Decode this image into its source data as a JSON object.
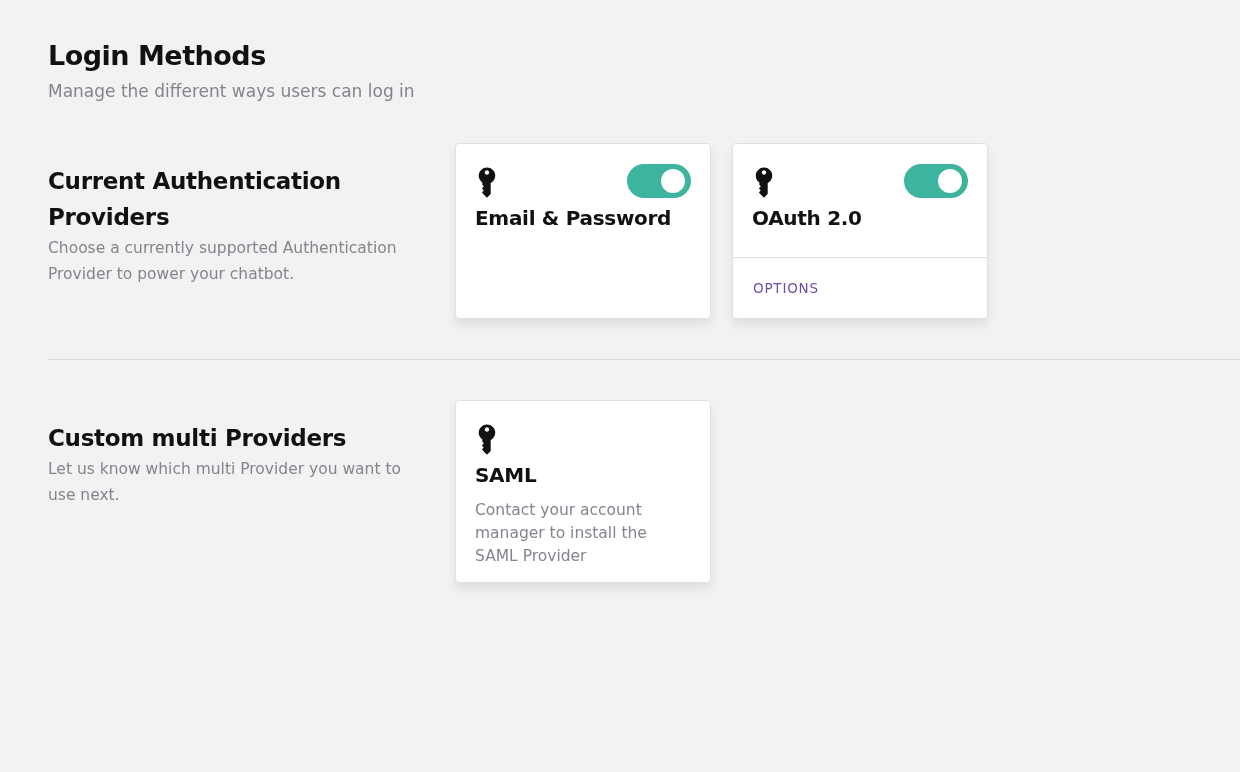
{
  "page": {
    "title": "Login Methods",
    "subtitle": "Manage the different ways users can log in"
  },
  "sections": [
    {
      "title": "Current Authentication Providers",
      "description": "Choose a currently supported Authentication Provider to power your chatbot.",
      "providers": [
        {
          "name": "Email & Password",
          "toggle": {
            "on": true
          }
        },
        {
          "name": "OAuth 2.0",
          "toggle": {
            "on": true
          },
          "footer_link": "OPTIONS"
        }
      ]
    },
    {
      "title": "Custom multi Providers",
      "description": "Let us know which multi Provider you want to use next.",
      "providers": [
        {
          "name": "SAML",
          "description": "Contact your account manager to install the SAML Provider"
        }
      ]
    }
  ]
}
